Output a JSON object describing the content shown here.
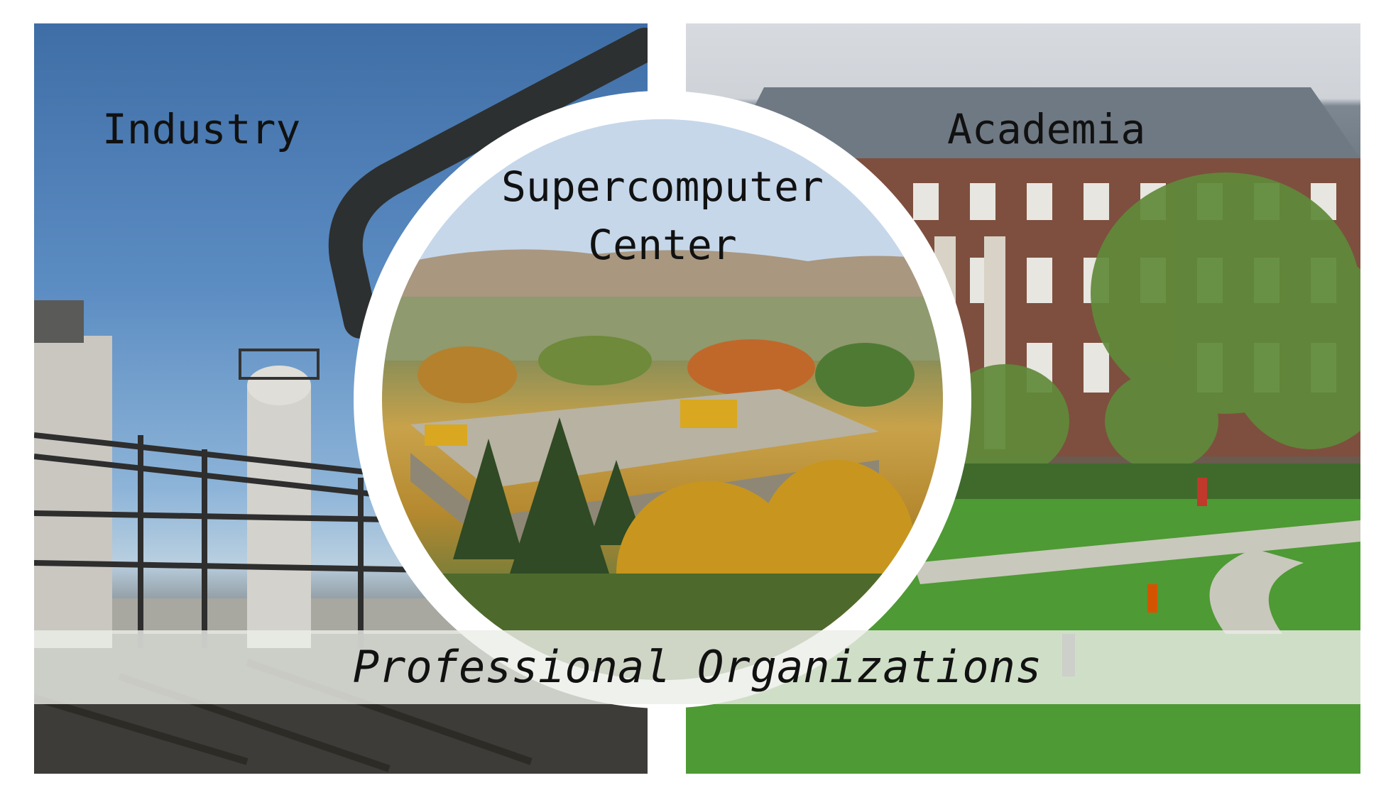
{
  "labels": {
    "industry": "Industry",
    "academia": "Academia",
    "center_line1": "Supercomputer",
    "center_line2": "Center",
    "professional": "Professional Organizations"
  },
  "images": {
    "industry": "industrial-plant-photo",
    "academia": "university-building-campus-photo",
    "center": "aerial-campus-autumn-photo"
  },
  "colors": {
    "background": "#ffffff",
    "text": "#111111",
    "band": "#ebeee8"
  }
}
